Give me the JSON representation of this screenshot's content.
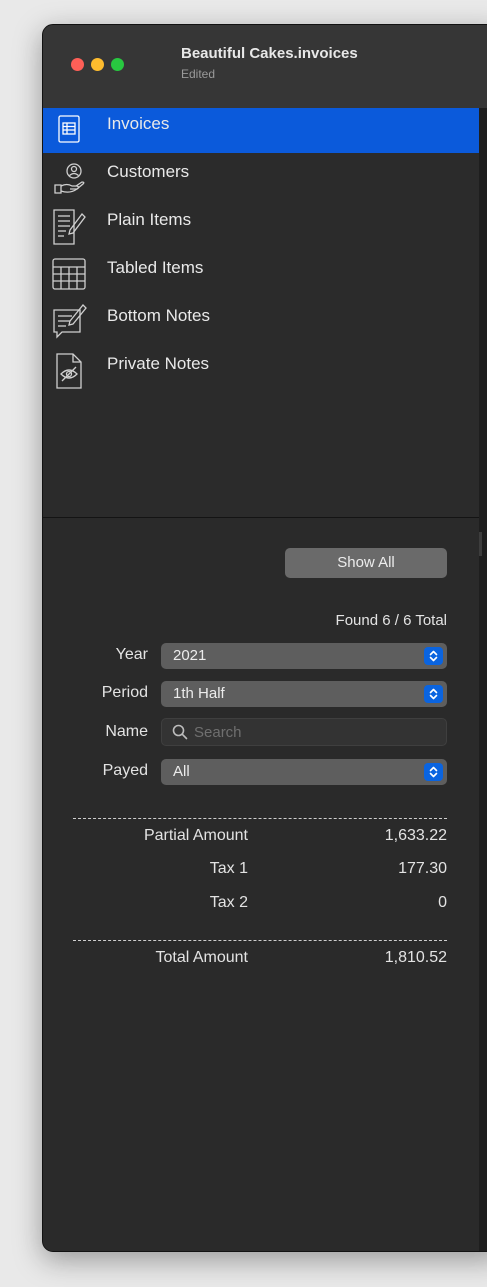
{
  "window": {
    "title": "Beautiful Cakes.invoices",
    "subtitle": "Edited",
    "controls": {
      "close": "#fe5f57",
      "minimize": "#febc2e",
      "zoom": "#28c840"
    }
  },
  "sidebar": {
    "selected_color": "#0b5adb",
    "items": [
      {
        "label": "Invoices",
        "icon": "invoice-icon",
        "selected": true
      },
      {
        "label": "Customers",
        "icon": "customer-hand-icon",
        "selected": false
      },
      {
        "label": "Plain Items",
        "icon": "document-pen-icon",
        "selected": false
      },
      {
        "label": "Tabled Items",
        "icon": "table-icon",
        "selected": false
      },
      {
        "label": "Bottom Notes",
        "icon": "note-pen-icon",
        "selected": false
      },
      {
        "label": "Private Notes",
        "icon": "eye-document-icon",
        "selected": false
      }
    ]
  },
  "filters": {
    "show_all_label": "Show All",
    "found_text": "Found 6 / 6 Total",
    "year": {
      "label": "Year",
      "value": "2021"
    },
    "period": {
      "label": "Period",
      "value": "1th Half"
    },
    "name": {
      "label": "Name",
      "placeholder": "Search",
      "value": ""
    },
    "payed": {
      "label": "Payed",
      "value": "All"
    }
  },
  "totals": {
    "partial_label": "Partial Amount",
    "partial_value": "1,633.22",
    "tax1_label": "Tax 1",
    "tax1_value": "177.30",
    "tax2_label": "Tax 2",
    "tax2_value": "0",
    "total_label": "Total Amount",
    "total_value": "1,810.52"
  }
}
